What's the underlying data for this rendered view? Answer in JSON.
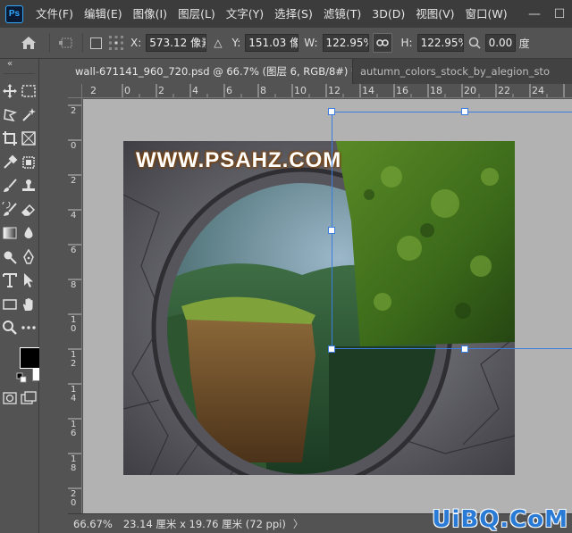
{
  "app": {
    "logo_text": "Ps",
    "menus": [
      "文件(F)",
      "编辑(E)",
      "图像(I)",
      "图层(L)",
      "文字(Y)",
      "选择(S)",
      "滤镜(T)",
      "3D(D)",
      "视图(V)",
      "窗口(W)"
    ],
    "window_controls": {
      "minimize": "—",
      "maximize": "☐"
    }
  },
  "options_bar": {
    "x_label": "X:",
    "x_value": "573.12 像素",
    "delta_symbol": "△",
    "y_label": "Y:",
    "y_value": "151.03 像素",
    "w_label": "W:",
    "w_value": "122.95%",
    "h_label": "H:",
    "h_value": "122.95%",
    "angle_value": "0.00",
    "angle_unit": "度"
  },
  "toolbar": {
    "collapse_label": "«"
  },
  "tabs": [
    {
      "label": "wall-671141_960_720.psd @ 66.7% (图层 6, RGB/8#) *",
      "close": "×"
    },
    {
      "label": "autumn_colors_stock_by_alegion_sto"
    }
  ],
  "rulers": {
    "top": [
      "2",
      "0",
      "2",
      "4",
      "6",
      "8",
      "10",
      "12",
      "14",
      "16",
      "18",
      "20",
      "22",
      "24"
    ],
    "left": [
      "2",
      "0",
      "2",
      "4",
      "6",
      "8",
      "1\n0",
      "1\n2",
      "1\n4",
      "1\n6",
      "1\n8",
      "2\n0",
      "2\n2"
    ]
  },
  "canvas": {
    "watermark_text": "WWW.PSAHZ.COM"
  },
  "status": {
    "zoom": "66.67%",
    "doc_info": "23.14 厘米 x 19.76 厘米 (72 ppi)",
    "arrow": "〉"
  },
  "site_watermark": "UiBQ.CoM"
}
